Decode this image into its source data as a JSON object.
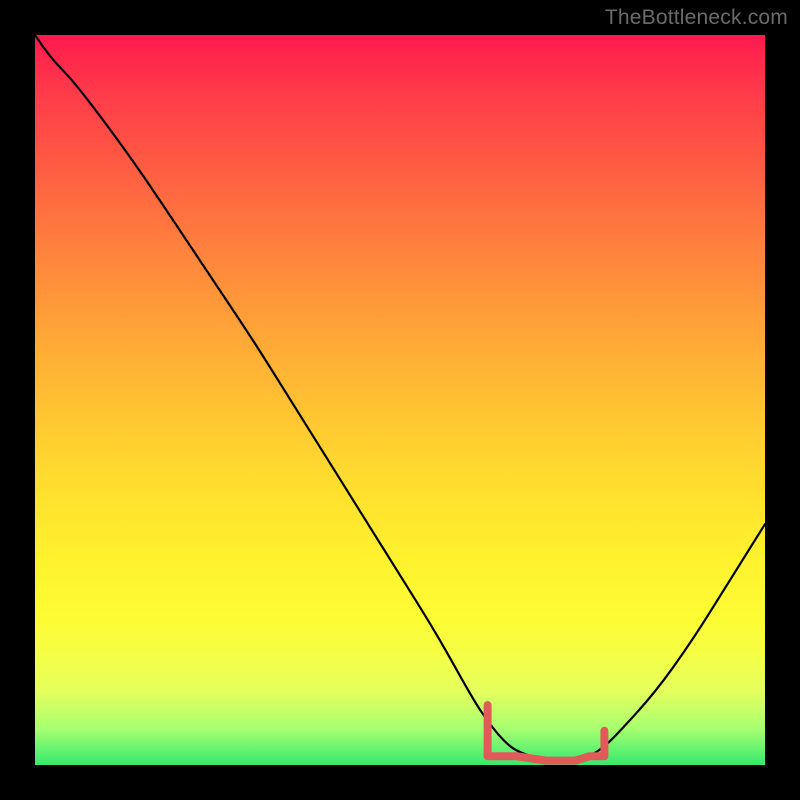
{
  "attribution": "TheBottleneck.com",
  "colors": {
    "frame": "#000000",
    "curve_stroke": "#000000",
    "red_segment": "#e15a5a",
    "gradient_top": "#ff1a4d",
    "gradient_bottom": "#35e96f"
  },
  "chart_data": {
    "type": "line",
    "title": "",
    "xlabel": "",
    "ylabel": "",
    "xlim": [
      0,
      100
    ],
    "ylim": [
      0,
      100
    ],
    "grid": false,
    "legend": false,
    "x": [
      0,
      2,
      5,
      10,
      15,
      20,
      25,
      30,
      35,
      40,
      45,
      50,
      55,
      60,
      62,
      64,
      66,
      70,
      74,
      76,
      78,
      80,
      85,
      90,
      95,
      100
    ],
    "series": [
      {
        "name": "bottleneck-curve",
        "values": [
          100,
          97,
          94,
          87.5,
          80.5,
          73,
          65.5,
          58,
          50,
          42,
          34,
          26,
          18,
          9,
          6,
          3.5,
          1.8,
          0.6,
          0.6,
          1.2,
          2.5,
          4.5,
          10,
          17,
          25,
          33
        ]
      }
    ],
    "annotations": [
      {
        "name": "ideal-band",
        "x_range": [
          62,
          78
        ],
        "y": 0.4,
        "color": "#e15a5a"
      }
    ]
  }
}
